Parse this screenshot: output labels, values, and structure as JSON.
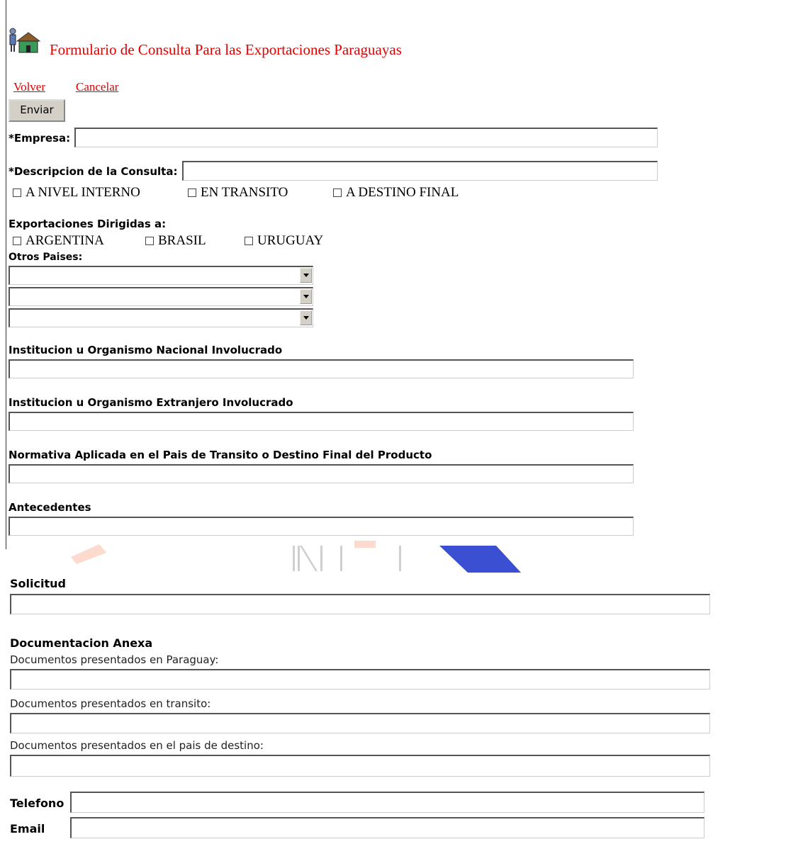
{
  "header": {
    "title": "Formulario de Consulta Para las Exportaciones Paraguayas",
    "icon": "person-house-icon"
  },
  "nav": {
    "volver": "Volver",
    "cancelar": "Cancelar",
    "enviar": "Enviar"
  },
  "fields": {
    "empresa": "*Empresa:",
    "descripcion": "*Descripcion de la Consulta:",
    "nivel_interno": "A NIVEL INTERNO",
    "en_transito": "EN TRANSITO",
    "destino_final": "A DESTINO FINAL",
    "exportaciones_label": "Exportaciones Dirigidas a:",
    "argentina": "ARGENTINA",
    "brasil": "BRASIL",
    "uruguay": "URUGUAY",
    "otros_paises": "Otros Paises:",
    "institucion_nacional": "Institucion u Organismo Nacional Involucrado",
    "institucion_extranjero": "Institucion u Organismo Extranjero Involucrado",
    "normativa": "Normativa Aplicada en el Pais de Transito o Destino Final del Producto",
    "antecedentes": "Antecedentes",
    "solicitud": "Solicitud",
    "documentacion_anexa": "Documentacion Anexa",
    "docs_paraguay": "Documentos presentados en Paraguay:",
    "docs_transito": "Documentos presentados en transito:",
    "docs_destino": "Documentos presentados en el pais de destino:",
    "telefono": "Telefono",
    "email": "Email"
  },
  "colors": {
    "accent": "#e00000",
    "watermark_orange": "#f26a3c",
    "watermark_blue": "#3a4fd1"
  }
}
